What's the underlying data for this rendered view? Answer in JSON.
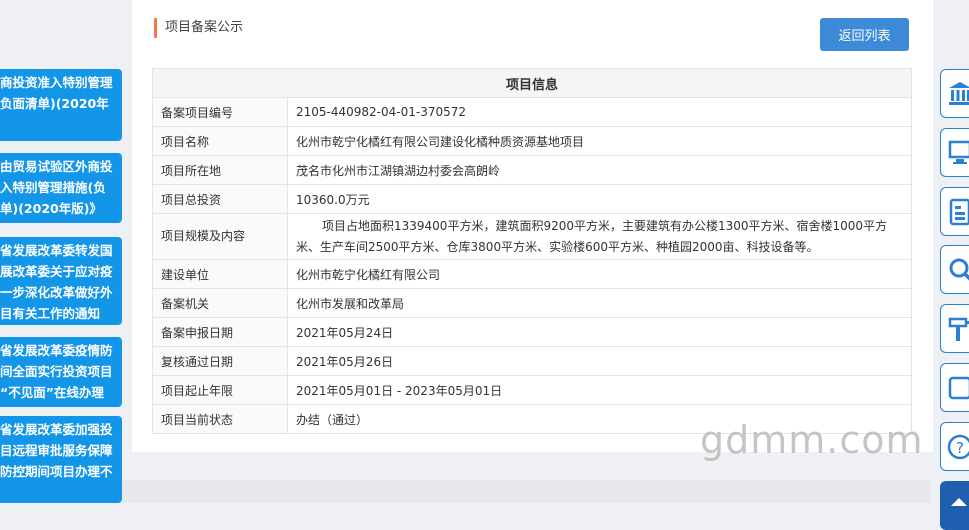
{
  "sidebar_notices": [
    {
      "lines": [
        "商投资准入特别管理",
        "负面清单)(2020年"
      ]
    },
    {
      "lines": [
        "由贸易试验区外商投",
        "入特别管理措施(负",
        "单)(2020年版)》"
      ]
    },
    {
      "lines": [
        "省发展改革委转发国",
        "展改革委关于应对疫",
        "一步深化改革做好外",
        "目有关工作的通知"
      ]
    },
    {
      "lines": [
        "省发展改革委疫情防",
        "间全面实行投资项目",
        "“不见面”在线办理"
      ]
    },
    {
      "lines": [
        "省发展改革委加强投",
        "目远程审批服务保障",
        "防控期间项目办理不"
      ]
    }
  ],
  "section_title": "项目备案公示",
  "back_button": "返回列表",
  "table": {
    "header": "项目信息",
    "rows": [
      {
        "label": "备案项目编号",
        "value": "2105-440982-04-01-370572"
      },
      {
        "label": "项目名称",
        "value": "化州市乾宁化橘红有限公司建设化橘种质资源基地项目"
      },
      {
        "label": "项目所在地",
        "value": "茂名市化州市江湖镇湖边村委会高朗岭"
      },
      {
        "label": "项目总投资",
        "value": "10360.0万元"
      },
      {
        "label": "项目规模及内容",
        "value": "项目占地面积1339400平方米，建筑面积9200平方米，主要建筑有办公楼1300平方米、宿舍楼1000平方米、生产车间2500平方米、仓库3800平方米、实验楼600平方米、种植园2000亩、科技设备等。"
      },
      {
        "label": "建设单位",
        "value": "化州市乾宁化橘红有限公司"
      },
      {
        "label": "备案机关",
        "value": "化州市发展和改革局"
      },
      {
        "label": "备案申报日期",
        "value": "2021年05月24日"
      },
      {
        "label": "复核通过日期",
        "value": "2021年05月26日"
      },
      {
        "label": "项目起止年限",
        "value": "2021年05月01日 - 2023年05月01日"
      },
      {
        "label": "项目当前状态",
        "value": "办结（通过）"
      }
    ]
  },
  "right_icons": [
    "bank-icon",
    "monitor-icon",
    "document-icon",
    "search-icon",
    "tools-icon",
    "folder-icon",
    "help-icon",
    "brand-icon"
  ],
  "watermark": "gdmm.com",
  "colors": {
    "accent_blue": "#1496e8",
    "button_blue": "#3d8bd8",
    "section_marker": "#f07a4c"
  }
}
